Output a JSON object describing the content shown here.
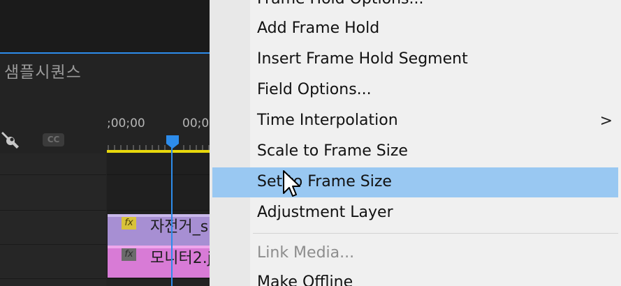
{
  "editor": {
    "sequence_tab": "샘플시퀀스",
    "timecodes": [
      ";00;00",
      "00;0"
    ],
    "cc_label": "CC",
    "clips": [
      {
        "label": "자전거_s",
        "fx": "fx"
      },
      {
        "label": "모니터2.j",
        "fx": "fx"
      }
    ]
  },
  "menu": {
    "items": [
      {
        "label": "Frame Hold Options...",
        "enabled": true
      },
      {
        "label": "Add Frame Hold",
        "enabled": true
      },
      {
        "label": "Insert Frame Hold Segment",
        "enabled": true
      },
      {
        "label": "Field Options...",
        "enabled": true
      },
      {
        "label": "Time Interpolation",
        "enabled": true,
        "submenu": ">"
      },
      {
        "label": "Scale to Frame Size",
        "enabled": true
      },
      {
        "label": "Set to Frame Size",
        "enabled": true,
        "highlighted": true
      },
      {
        "label": "Adjustment Layer",
        "enabled": true
      },
      {
        "label": "Link Media...",
        "enabled": false
      },
      {
        "label": "Make Offline",
        "enabled": true
      }
    ]
  },
  "colors": {
    "highlight": "#99c8f2",
    "playhead": "#2d8ceb",
    "work_area": "#e8d80c",
    "clip_purple": "#a78fd3",
    "clip_pink": "#d87bd6"
  }
}
